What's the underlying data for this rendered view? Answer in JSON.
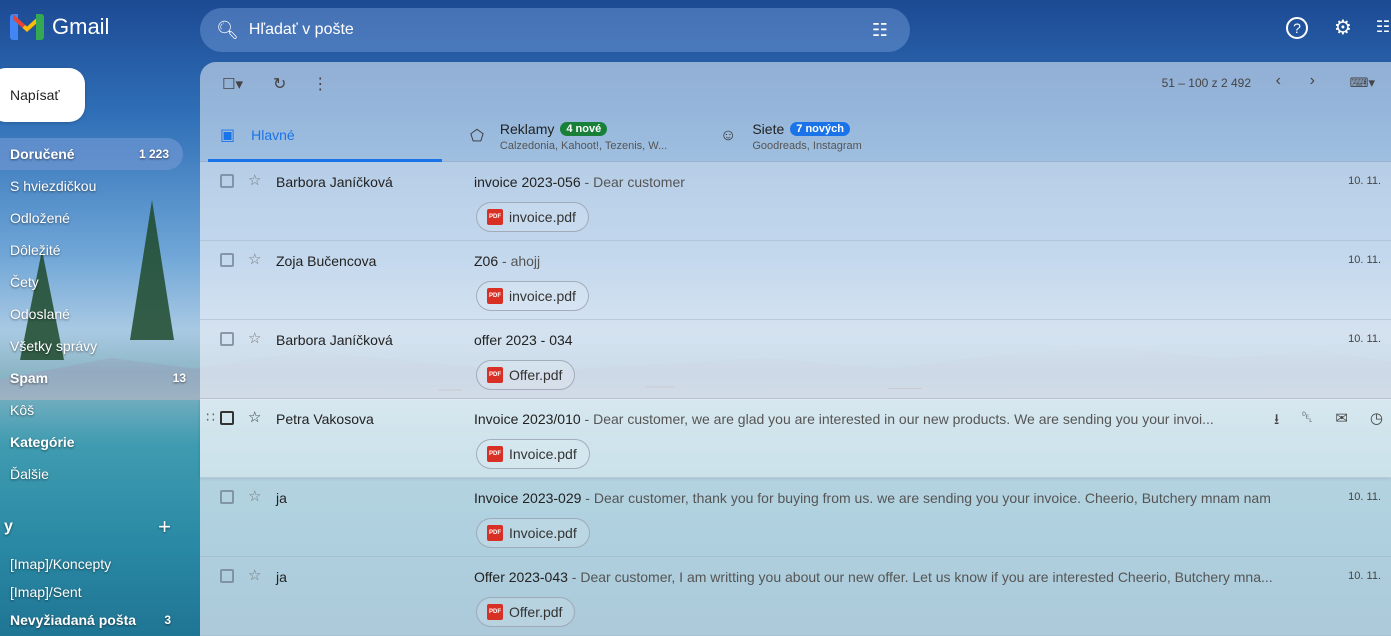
{
  "app": {
    "name": "Gmail"
  },
  "search": {
    "placeholder": "Hľadať v pošte"
  },
  "sidebar": {
    "compose": "Napísať",
    "items": [
      {
        "label": "Doručené",
        "count": "1 223",
        "active": true
      },
      {
        "label": "S hviezdičkou",
        "count": ""
      },
      {
        "label": "Odložené",
        "count": ""
      },
      {
        "label": "Dôležité",
        "count": ""
      },
      {
        "label": "Čety",
        "count": ""
      },
      {
        "label": "Odoslané",
        "count": ""
      },
      {
        "label": "Všetky správy",
        "count": ""
      },
      {
        "label": "Spam",
        "count": "13",
        "bold": true
      },
      {
        "label": "Kôš",
        "count": ""
      },
      {
        "label": "Kategórie",
        "count": "",
        "bold": true
      },
      {
        "label": "Ďalšie",
        "count": ""
      }
    ],
    "labels_heading": "y",
    "labels": [
      {
        "label": "[Imap]/Koncepty",
        "count": ""
      },
      {
        "label": "[Imap]/Sent",
        "count": ""
      },
      {
        "label": "Nevyžiadaná pošta",
        "count": "3",
        "bold": true
      }
    ]
  },
  "toolbar": {
    "pagination": "51 – 100 z 2 492"
  },
  "tabs": [
    {
      "name": "Hlavné",
      "badge": "",
      "sub": "",
      "icon": "inbox-icon"
    },
    {
      "name": "Reklamy",
      "badge": "4 nové",
      "sub": "Calzedonia, Kahoot!, Tezenis, W...",
      "icon": "tag-icon"
    },
    {
      "name": "Siete",
      "badge": "7 nových",
      "sub": "Goodreads, Instagram",
      "icon": "people-icon"
    }
  ],
  "emails": [
    {
      "sender": "Barbora Janíčková",
      "subject": "invoice 2023-056",
      "snippet": " - Dear customer",
      "attachment": "invoice.pdf",
      "date": "10. 11."
    },
    {
      "sender": "Zoja Bučencova",
      "subject": "Z06",
      "snippet": " - ahojj",
      "attachment": "invoice.pdf",
      "date": "10. 11."
    },
    {
      "sender": "Barbora Janíčková",
      "subject": "offer 2023 - 034",
      "snippet": "",
      "attachment": "Offer.pdf",
      "date": "10. 11."
    },
    {
      "sender": "Petra Vakosova",
      "subject": "Invoice 2023/010",
      "snippet": " - Dear customer, we are glad you are interested in our new products. We are sending you your invoi...",
      "attachment": "Invoice.pdf",
      "date": ""
    },
    {
      "sender": "ja",
      "subject": "Invoice 2023-029",
      "snippet": " - Dear customer, thank you for buying from us. we are sending you your invoice. Cheerio, Butchery mnam nam",
      "attachment": "Invoice.pdf",
      "date": "10. 11."
    },
    {
      "sender": "ja",
      "subject": "Offer 2023-043",
      "snippet": " - Dear customer, I am writting you about our new offer. Let us know if you are interested Cheerio, Butchery mna...",
      "attachment": "Offer.pdf",
      "date": "10. 11."
    }
  ],
  "colors": {
    "accent": "#1a73e8",
    "badge_green": "#188038"
  }
}
